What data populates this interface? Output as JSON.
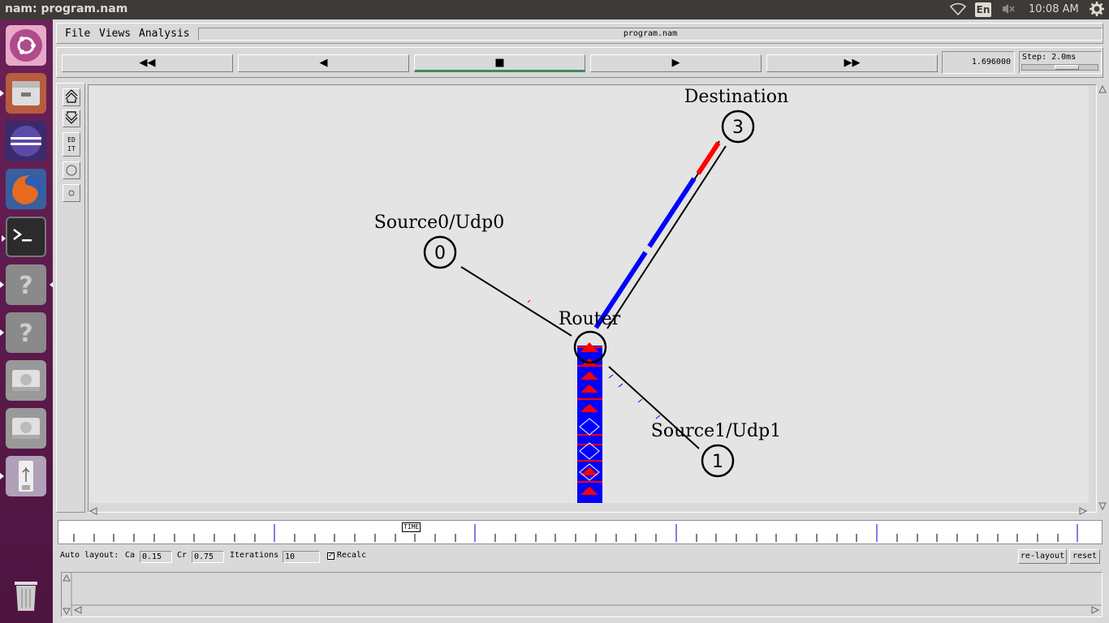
{
  "topbar": {
    "window_title": "nam: program.nam",
    "keyboard": "En",
    "clock": "10:08 AM"
  },
  "launcher": {
    "items": [
      {
        "name": "ubuntu-dash-icon"
      },
      {
        "name": "files-icon"
      },
      {
        "name": "eclipse-icon"
      },
      {
        "name": "firefox-icon"
      },
      {
        "name": "terminal-icon"
      },
      {
        "name": "unknown-app-icon"
      },
      {
        "name": "unknown-app-icon"
      },
      {
        "name": "drive-icon"
      },
      {
        "name": "drive-icon"
      },
      {
        "name": "usb-icon"
      },
      {
        "name": "trash-icon"
      }
    ],
    "unknown_glyph": "?"
  },
  "menubar": {
    "file": "File",
    "views": "Views",
    "analysis": "Analysis",
    "filename": "program.nam"
  },
  "playback": {
    "rewind": "◀◀",
    "back": "◀",
    "stop": "■",
    "play": "▶",
    "fastforward": "▶▶",
    "current_time": "1.696000",
    "step_label": "Step: 2.0ms"
  },
  "tools": {
    "edit_label_1": "ED",
    "edit_label_2": "IT"
  },
  "topology": {
    "nodes": [
      {
        "id": "0",
        "label": "Source0/Udp0"
      },
      {
        "id": "1",
        "label": "Source1/Udp1"
      },
      {
        "id": "3",
        "label": "Destination"
      },
      {
        "id": "",
        "label": "Router"
      }
    ]
  },
  "timeline": {
    "marker_label": "TIME"
  },
  "autolayout": {
    "label": "Auto layout:",
    "ca_label": "Ca",
    "ca_value": "0.15",
    "cr_label": "Cr",
    "cr_value": "0.75",
    "iterations_label": "Iterations",
    "iterations_value": "10",
    "recalc_label": "Recalc",
    "recalc_checked": true,
    "relayout": "re-layout",
    "reset": "reset"
  },
  "colors": {
    "packet_red": "#ff0000",
    "packet_blue": "#0000ff",
    "launcher_bg": "#5b1a4b",
    "panel_bg": "#3c3b37"
  }
}
